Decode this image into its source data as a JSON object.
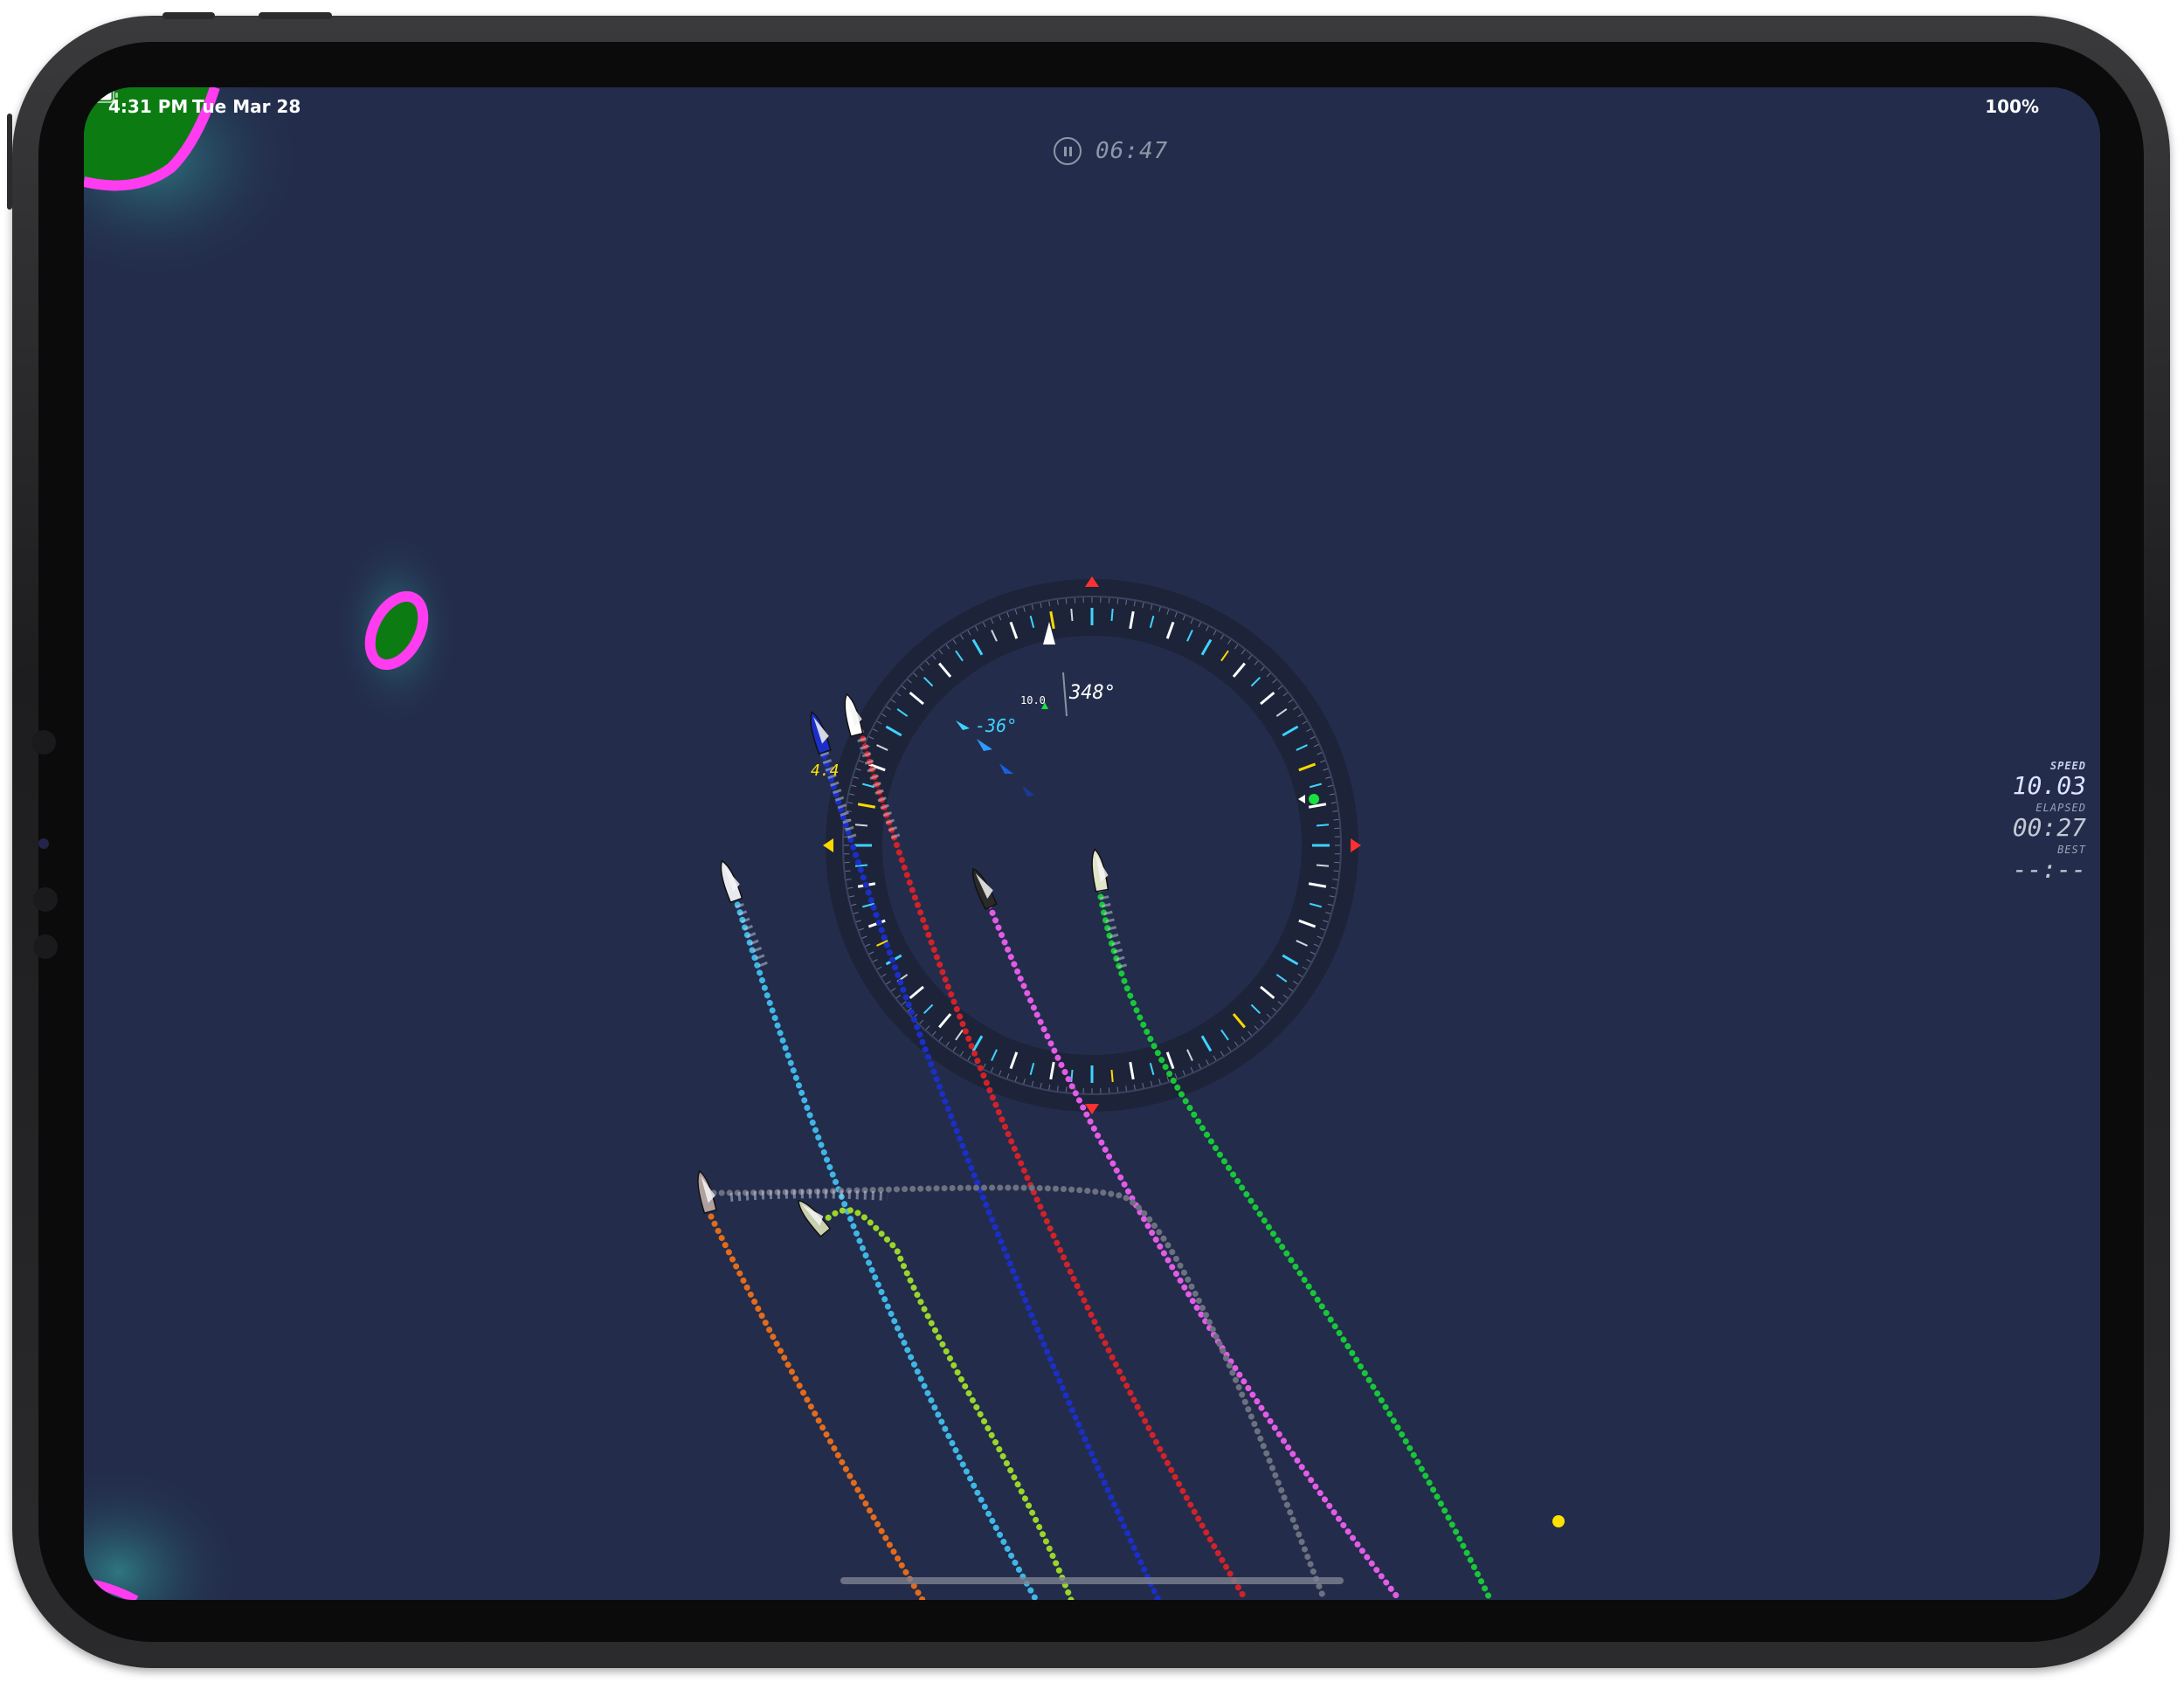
{
  "status_bar": {
    "time": "4:31 PM",
    "date": "Tue Mar 28",
    "battery": "100%"
  },
  "race_timer": {
    "value": "06:47",
    "state": "paused-toggle"
  },
  "hud": {
    "speed_label": "SPEED",
    "speed_value": "10.03",
    "elapsed_label": "ELAPSED",
    "elapsed_value": "00:27",
    "best_label": "BEST",
    "best_value": "--:--"
  },
  "compass": {
    "heading": "348°",
    "wind_angle": "-36°",
    "wind_speed": "10.0"
  },
  "boat_label": "4.4",
  "track_colors": {
    "cyan": "#3fb6e6",
    "blue": "#1a2fc8",
    "red": "#d1222a",
    "pink": "#e35be6",
    "green": "#18c63a",
    "gray": "#6c7180",
    "orange": "#e36b1b",
    "lime": "#9ad62a",
    "magenta_boundary": "#ff3cf0",
    "island_green": "#0c7c12",
    "sea": "#232d4b"
  }
}
